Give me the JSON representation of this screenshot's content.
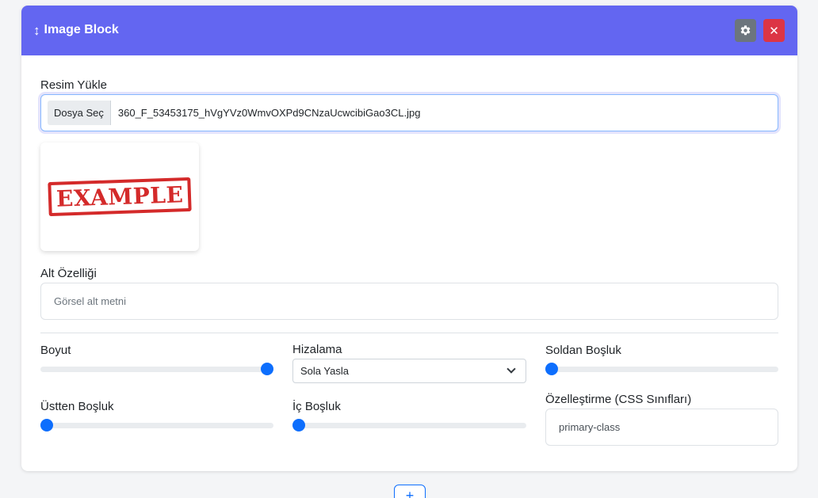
{
  "block": {
    "title": "Image Block",
    "drag_icon": "↕",
    "settings_icon": "gear-icon",
    "close_icon": "close-icon",
    "colors": {
      "header": "#6366f1",
      "settings": "#6c757d",
      "close": "#dc3545",
      "accent": "#0d6efd"
    }
  },
  "upload": {
    "label": "Resim Yükle",
    "button_label": "Dosya Seç",
    "file_name": "360_F_53453175_hVgYVz0WmvOXPd9CNzaUcwcibiGao3CL.jpg"
  },
  "preview": {
    "stamp_text": "EXAMPLE"
  },
  "alt": {
    "label": "Alt Özelliği",
    "placeholder": "Görsel alt metni"
  },
  "size": {
    "label": "Boyut",
    "value_percent": 100
  },
  "align": {
    "label": "Hizalama",
    "selected": "Sola Yasla"
  },
  "margin_left": {
    "label": "Soldan Boşluk",
    "value_percent": 0
  },
  "margin_top": {
    "label": "Üstten Boşluk",
    "value_percent": 0
  },
  "padding": {
    "label": "İç Boşluk",
    "value_percent": 0
  },
  "custom_classes": {
    "label": "Özelleştirme (CSS Sınıfları)",
    "value": "primary-class"
  },
  "add_block": {
    "label": "+"
  }
}
